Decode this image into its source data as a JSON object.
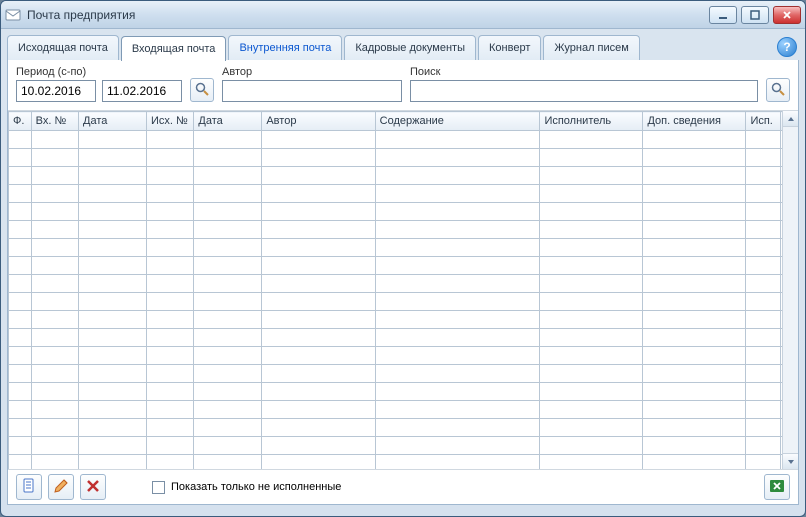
{
  "window": {
    "title": "Почта предприятия"
  },
  "tabs": [
    {
      "label": "Исходящая почта",
      "active": false,
      "blue": false
    },
    {
      "label": "Входящая почта",
      "active": true,
      "blue": false
    },
    {
      "label": "Внутренняя почта",
      "active": false,
      "blue": true
    },
    {
      "label": "Кадровые документы",
      "active": false,
      "blue": false
    },
    {
      "label": "Конверт",
      "active": false,
      "blue": false
    },
    {
      "label": "Журнал писем",
      "active": false,
      "blue": false
    }
  ],
  "help": {
    "label": "?"
  },
  "filter": {
    "period_label": "Период (с-по)",
    "date_from": "10.02.2016",
    "date_to": "11.02.2016",
    "author_label": "Автор",
    "author_value": "",
    "search_label": "Поиск",
    "search_value": ""
  },
  "columns": [
    {
      "label": "Ф.",
      "width": 22
    },
    {
      "label": "Вх. №",
      "width": 46
    },
    {
      "label": "Дата",
      "width": 66
    },
    {
      "label": "Исх. №",
      "width": 46
    },
    {
      "label": "Дата",
      "width": 66
    },
    {
      "label": "Автор",
      "width": 110
    },
    {
      "label": "Содержание",
      "width": 160
    },
    {
      "label": "Исполнитель",
      "width": 100
    },
    {
      "label": "Доп. сведения",
      "width": 100
    },
    {
      "label": "Исп.",
      "width": 34
    }
  ],
  "row_count": 20,
  "footer": {
    "checkbox_label": "Показать только не исполненные",
    "checkbox_checked": false
  }
}
